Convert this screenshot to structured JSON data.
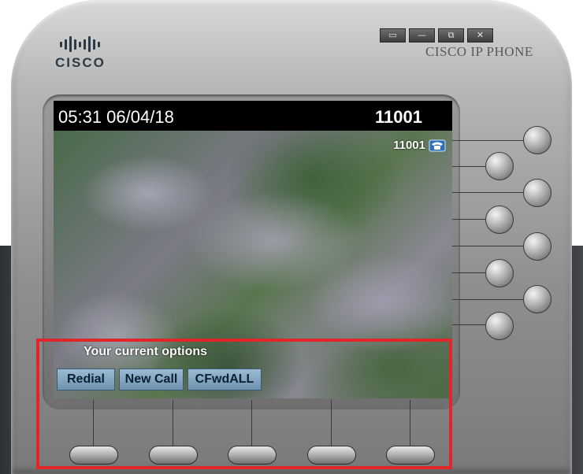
{
  "brand": {
    "logo_text": "CISCO",
    "product_label": "CISCO IP PHONE"
  },
  "window_controls": [
    {
      "name": "restore",
      "icon": "restore-icon",
      "glyph": "▭"
    },
    {
      "name": "minimize",
      "icon": "minimize-icon",
      "glyph": "—"
    },
    {
      "name": "maximize",
      "icon": "maximize-icon",
      "glyph": "⧉"
    },
    {
      "name": "close",
      "icon": "close-icon",
      "glyph": "✕"
    }
  ],
  "screen": {
    "datetime": "05:31 06/04/18",
    "extension": "11001",
    "line": {
      "label": "11001",
      "icon": "handset-icon"
    },
    "options_title": "Your current options",
    "softkeys": [
      "Redial",
      "New Call",
      "CFwdALL"
    ]
  },
  "colors": {
    "softkey_bg": "#8fb0c8",
    "highlight": "#e0262a",
    "status_bar": "#000000"
  }
}
